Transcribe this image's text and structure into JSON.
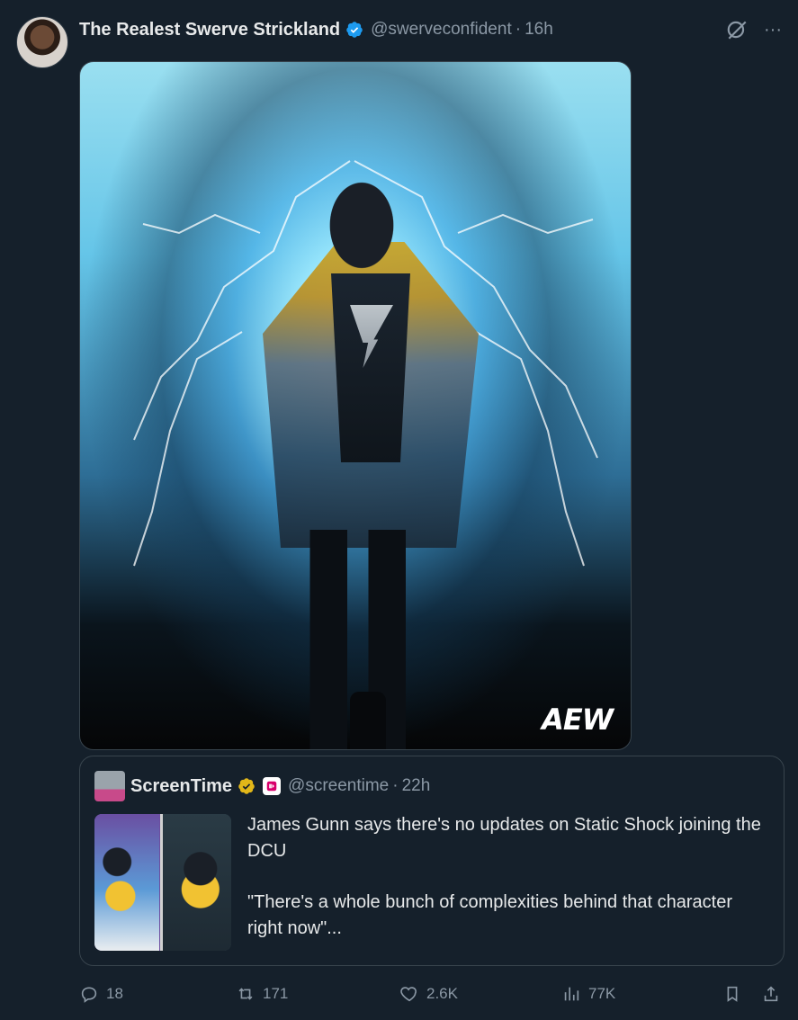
{
  "post": {
    "author": {
      "display_name": "The Realest Swerve Strickland",
      "handle": "@swerveconfident",
      "time": "16h"
    },
    "media": {
      "watermark": "AEW"
    },
    "quote": {
      "author": {
        "display_name": "ScreenTime",
        "handle": "@screentime",
        "time": "22h"
      },
      "text_line1": "James Gunn says there's no updates on Static Shock joining the DCU",
      "text_line2": "\"There's a whole bunch of complexities behind that character right now\"..."
    },
    "stats": {
      "replies": "18",
      "reposts": "171",
      "likes": "2.6K",
      "views": "77K"
    }
  },
  "ui": {
    "separator": "·",
    "more_glyph": "···"
  },
  "colors": {
    "background": "#15202b",
    "text_primary": "#e7e9ea",
    "text_secondary": "#8b98a5",
    "verified_blue": "#1d9bf0",
    "verified_gold": "#e2b719",
    "border": "#38444d"
  }
}
